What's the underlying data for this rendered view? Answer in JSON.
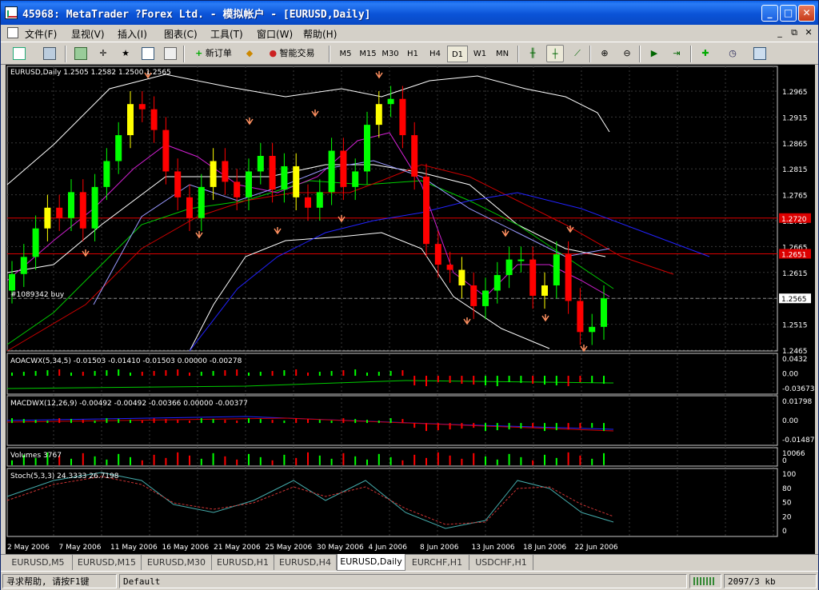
{
  "window": {
    "title": "45968: MetaTrader ?Forex Ltd. - 模拟帐户 - [EURUSD,Daily]",
    "buttons": {
      "minimize": "_",
      "maximize": "□",
      "close": "✕"
    }
  },
  "menu": {
    "items": [
      "文件(F)",
      "显视(V)",
      "插入(I)",
      "图表(C)",
      "工具(T)",
      "窗口(W)",
      "帮助(H)"
    ],
    "mdi_controls": {
      "minimize": "_",
      "restore": "⧉",
      "close": "✕"
    }
  },
  "toolbar": {
    "new_order": "新订单",
    "expert_advisors": "智能交易",
    "timeframes": [
      "M5",
      "M15",
      "M30",
      "H1",
      "H4",
      "D1",
      "W1",
      "MN"
    ],
    "active_timeframe": "D1"
  },
  "chart": {
    "symbol_header": "EURUSD,Daily  1.2505  1.2582  1.2500  1.2565",
    "order_label": "#1089342 buy",
    "price_labels": [
      "1.2965",
      "1.2915",
      "1.2865",
      "1.2815",
      "1.2765",
      "1.2715",
      "1.2665",
      "1.2615",
      "1.2565",
      "1.2515",
      "1.2465"
    ],
    "current_price": "1.2565",
    "red_level_1": "1.2720",
    "red_level_2": "1.2651",
    "date_labels": [
      "2 May 2006",
      "7 May 2006",
      "11 May 2006",
      "16 May 2006",
      "21 May 2006",
      "25 May 2006",
      "30 May 2006",
      "4 Jun 2006",
      "8 Jun 2006",
      "13 Jun 2006",
      "18 Jun 2006",
      "22 Jun 2006"
    ],
    "colors": {
      "background": "#000000",
      "grid": "#3a3a3a",
      "bull_candle": "#00ff00",
      "bear_candle": "#ff0000",
      "yellow_candle": "#ffff00",
      "axis_text": "#ffffff"
    }
  },
  "panels": {
    "ao": {
      "label": "AOACWX(5,34,5) -0.01503 -0.01410 -0.01503 0.00000 -0.00278",
      "scale": [
        "0.0432",
        "0.00",
        "-0.03673"
      ]
    },
    "macd": {
      "label": "MACDWX(12,26,9) -0.00492 -0.00492 -0.00366 0.00000 -0.00377",
      "scale": [
        "0.01798",
        "0.00",
        "-0.01487"
      ]
    },
    "volumes": {
      "label": "Volumes 3767",
      "scale": [
        "10066",
        "0"
      ]
    },
    "stoch": {
      "label": "Stoch(5,3,3) 24.3333 26.7198",
      "scale": [
        "100",
        "80",
        "50",
        "20",
        "0"
      ]
    }
  },
  "tabs": [
    "EURUSD,M5",
    "EURUSD,M15",
    "EURUSD,M30",
    "EURUSD,H1",
    "EURUSD,H4",
    "EURUSD,Daily",
    "EURCHF,H1",
    "USDCHF,H1"
  ],
  "active_tab": "EURUSD,Daily",
  "status": {
    "help": "寻求帮助, 请按F1键",
    "profile": "Default",
    "traffic": "2097/3 kb"
  }
}
